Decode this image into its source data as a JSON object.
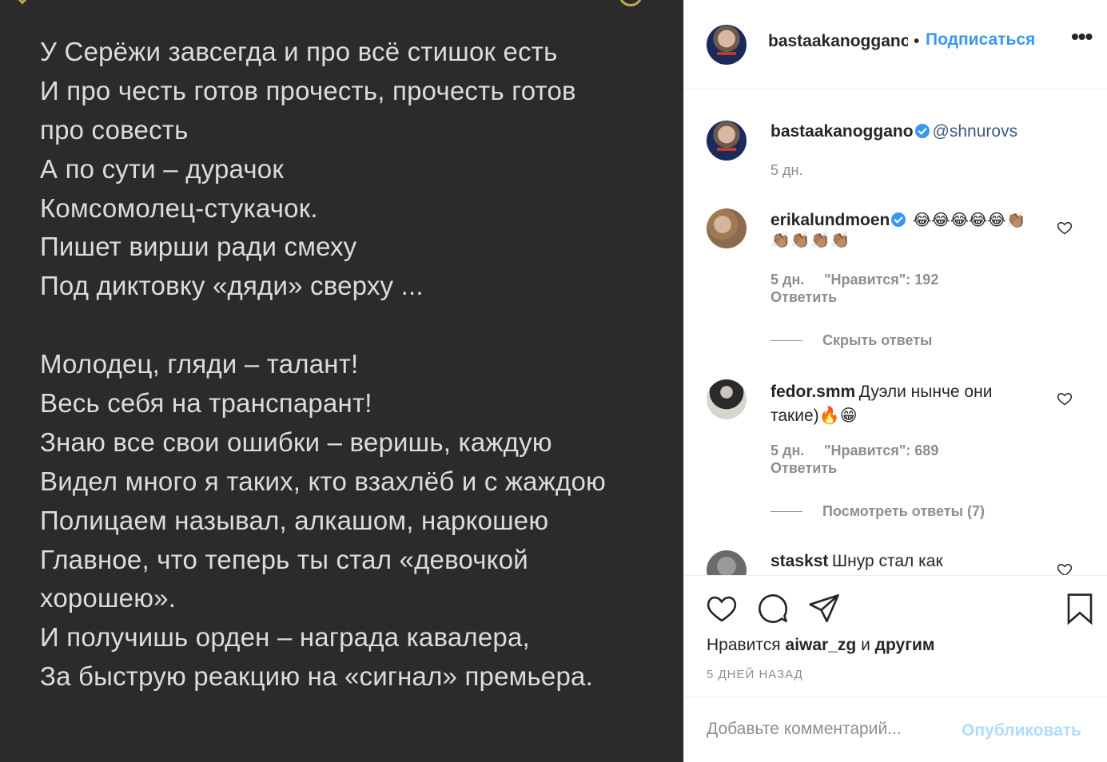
{
  "post": {
    "poem_lines": [
      "У Серёжи завсегда и про всё стишок есть",
      "И про честь готов прочесть, прочесть готов",
      "про совесть",
      "А по сути – дурачок",
      "Комсомолец-стукачок.",
      "Пишет вирши ради смеху",
      "Под диктовку «дяди» сверху ...",
      "",
      "Молодец, гляди – талант!",
      "Весь себя на транспарант!",
      "Знаю все свои ошибки – веришь, каждую",
      "Видел много я таких, кто взахлёб и с жаждою",
      "Полицаем называл, алкашом, наркошею",
      "Главное, что теперь ты стал «девочкой",
      "хорошею».",
      "И получишь орден – награда кавалера,",
      "За быструю реакцию на «сигнал» премьера."
    ]
  },
  "header": {
    "username": "bastaakanoggano",
    "dot": "•",
    "follow_label": "Подписаться",
    "more_label": "•••"
  },
  "caption": {
    "username": "bastaakanoggano",
    "mention": "@shnurovs",
    "time": "5 дн."
  },
  "comments": [
    {
      "username": "erikalundmoen",
      "text": "😂😂😂😂😂👏🏽",
      "text2": "👏🏽👏🏽👏🏽👏🏽",
      "time": "5 дн.",
      "likes": "\"Нравится\": 192",
      "reply": "Ответить",
      "toggle": "Скрыть ответы"
    },
    {
      "username": "fedor.smm",
      "text": "Дуэли нынче они",
      "text2": "такие)🔥😁",
      "time": "5 дн.",
      "likes": "\"Нравится\": 689",
      "reply": "Ответить",
      "toggle": "Посмотреть ответы (7)"
    },
    {
      "username": "staskst",
      "text": "Шнур стал как"
    }
  ],
  "actions": {
    "likes_prefix": "Нравится",
    "likes_user": "aiwar_zg",
    "likes_mid": "и",
    "likes_suffix": "другим",
    "time_ago": "5 ДНЕЙ НАЗАД"
  },
  "add_comment": {
    "placeholder": "Добавьте комментарий...",
    "publish_label": "Опубликовать"
  },
  "colors": {
    "accent": "#3897f0",
    "post_bg": "#2b2b2b",
    "poem_text": "#dcdcdc",
    "muted": "#8e8e8e"
  }
}
